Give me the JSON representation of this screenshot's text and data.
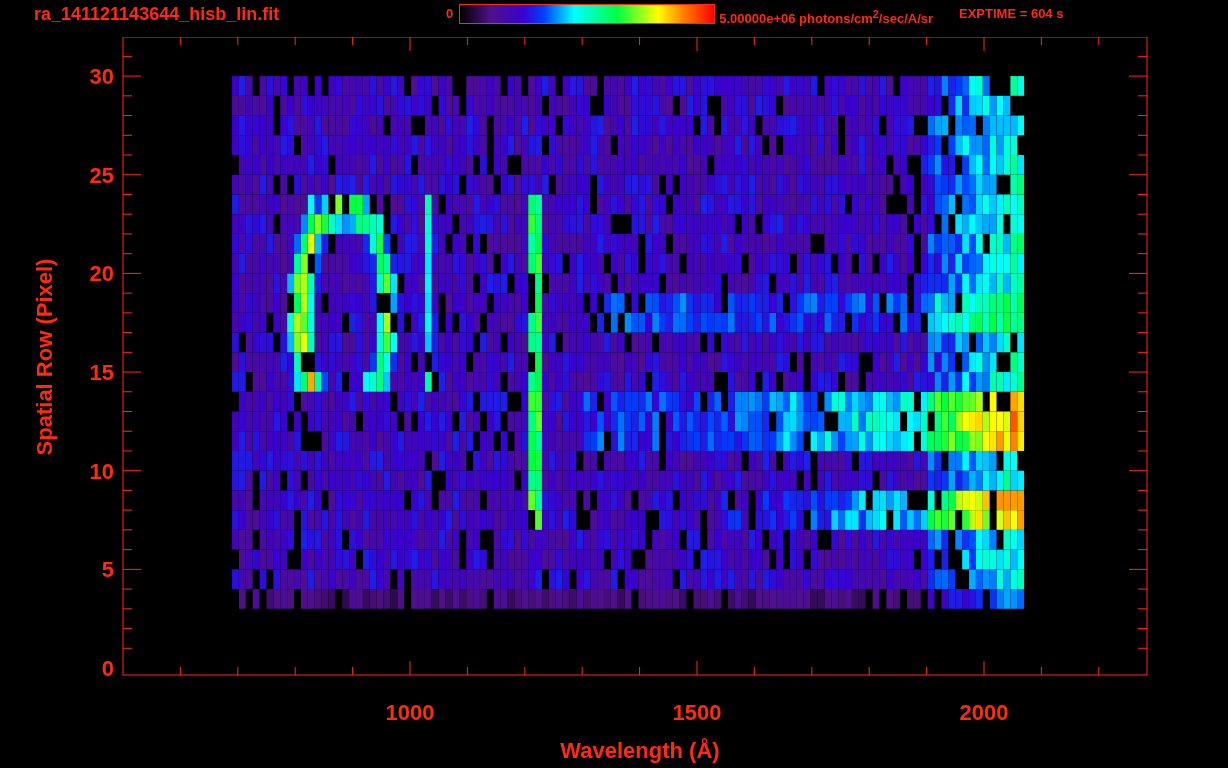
{
  "title": "ra_141121143644_hisb_lin.fit",
  "colorbar": {
    "min_label": "0",
    "max_label": "5.00000e+06 photons/cm$^{2}$/sec/A/sr"
  },
  "exptime": "EXPTIME = 604 s",
  "axes": {
    "xlabel": "Wavelength (Å)",
    "ylabel": "Spatial Row (Pixel)",
    "xticks": [
      "1000",
      "1500",
      "2000"
    ],
    "yticks": [
      "30",
      "25",
      "20",
      "15",
      "10",
      "5",
      "0"
    ]
  }
}
